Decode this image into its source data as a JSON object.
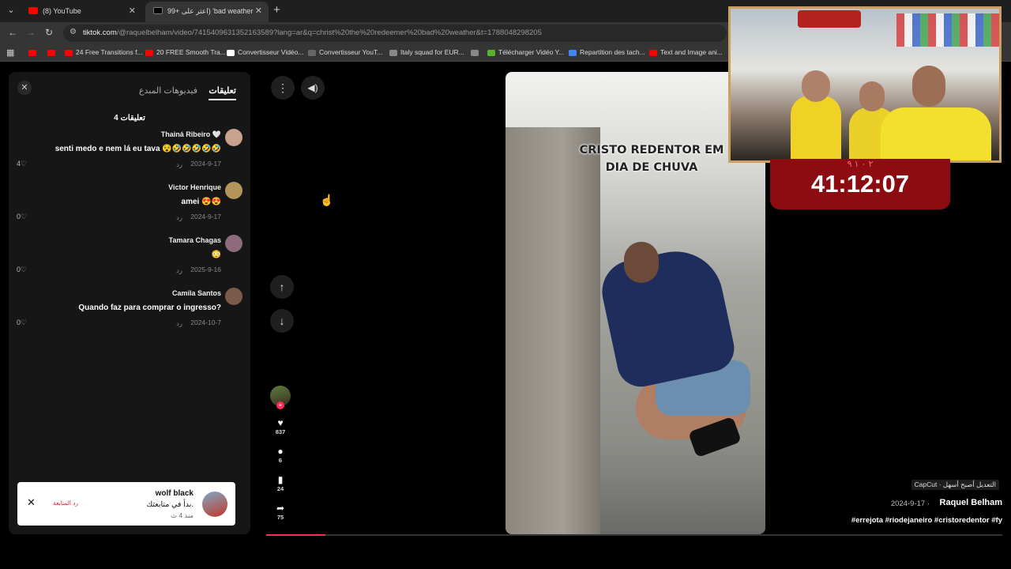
{
  "browser": {
    "tabs": [
      {
        "title": "(8) YouTube",
        "favicon_color": "#ff0000"
      },
      {
        "title": "اعثر على +99) 'bad weather",
        "favicon_color": "#000000",
        "speaker": "🔊"
      }
    ],
    "url_host": "tiktok.com",
    "url_path": "/@raquelbelham/video/7415409631352163589?lang=ar&q=christ%20the%20redeemer%20bad%20weather&t=1788048298205",
    "bookmarks": [
      {
        "label": "",
        "color": "#ff0000"
      },
      {
        "label": "",
        "color": "#ff0000"
      },
      {
        "label": "24 Free Transitions f...",
        "color": "#ff0000"
      },
      {
        "label": "20 FREE Smooth Tra...",
        "color": "#ff0000"
      },
      {
        "label": "Convertisseur Vidéo...",
        "color": "#ffffff"
      },
      {
        "label": "Convertisseur YouT...",
        "color": "#666666"
      },
      {
        "label": "Italy squad for EUR...",
        "color": "#888888"
      },
      {
        "label": "",
        "color": "#888888"
      },
      {
        "label": "Télécharger Vidéo Y...",
        "color": "#5ab12b"
      },
      {
        "label": "Repartition des tach...",
        "color": "#4285f4"
      },
      {
        "label": "Text and Image ani...",
        "color": "#ff0000"
      }
    ]
  },
  "comments_panel": {
    "tab_comments": "تعليقات",
    "tab_creator_videos": "فيديوهات المبدع",
    "count_label": "4 تعليقات",
    "reply_label": "رد",
    "items": [
      {
        "name": "Thainá Ribeiro 🤍",
        "text": "senti medo e nem lá eu tava 😵🤣🤣🤣🤣🤣",
        "date": "2024-9-17",
        "likes": "4",
        "avatar_color": "#c9a28f"
      },
      {
        "name": "Victor Henrique",
        "text": "amei 😍😍",
        "date": "2024-9-17",
        "likes": "0",
        "avatar_color": "#b3945a"
      },
      {
        "name": "Tamara Chagas",
        "text": "😳",
        "date": "2025-9-16",
        "likes": "0",
        "avatar_color": "#8f6b7e"
      },
      {
        "name": "Camila Santos",
        "text": "Quando faz para comprar o ingresso?",
        "date": "2024-10-7",
        "likes": "0",
        "avatar_color": "#7a5a4a"
      }
    ]
  },
  "notification": {
    "name": "wolf black",
    "message": "بدأ في متابعتك.",
    "time": "منذ 4 ث",
    "follow_back": "رد المتابعة"
  },
  "video": {
    "caption_line1": "CRISTO REDENTOR EM",
    "caption_line2": "DIA DE CHUVA",
    "likes": "837",
    "comments": "6",
    "saves": "24",
    "shares": "75",
    "progress": 0.08
  },
  "meta": {
    "capcut": "CapCut · التعديل أصبح أسهل",
    "author": "Raquel Belham",
    "date": "2024-9-17 ·",
    "hashtags": "#errejota #riodejaneiro #cristoredentor #fy"
  },
  "overlay": {
    "timer": "41:12:07",
    "timer_deco": "٢ ٠ ١ ٩"
  }
}
